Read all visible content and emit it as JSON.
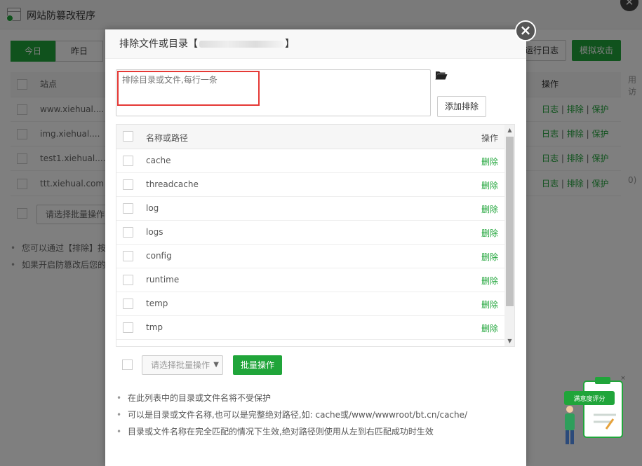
{
  "window": {
    "title": "网站防篡改程序"
  },
  "tabs": [
    {
      "label": "今日"
    },
    {
      "label": "昨日"
    }
  ],
  "toolbar": {
    "log_button": "运行日志",
    "simulate_button": "模拟攻击"
  },
  "bg_table": {
    "headers": {
      "site": "站点",
      "ops": "操作"
    },
    "rows": [
      {
        "name": "www.xiehual...."
      },
      {
        "name": "img.xiehual...."
      },
      {
        "name": "test1.xiehual...."
      },
      {
        "name": "ttt.xiehual.com"
      }
    ],
    "op_log": "日志",
    "op_exclude": "排除",
    "op_protect": "保护",
    "sep": "|"
  },
  "bg_batch": {
    "placeholder": "请选择批量操作"
  },
  "bg_tips": [
    "您可以通过【排除】按",
    "如果开启防篡改后您的"
  ],
  "side_edge": {
    "top": "用访",
    "bottom": "0)"
  },
  "modal": {
    "title_prefix": "排除文件或目录【",
    "title_suffix": "】",
    "textarea_placeholder": "排除目录或文件,每行一条",
    "add_button": "添加排除",
    "list": {
      "header_name": "名称或路径",
      "header_op": "操作",
      "delete_label": "删除",
      "rows": [
        {
          "name": "cache"
        },
        {
          "name": "threadcache"
        },
        {
          "name": "log"
        },
        {
          "name": "logs"
        },
        {
          "name": "config"
        },
        {
          "name": "runtime"
        },
        {
          "name": "temp"
        },
        {
          "name": "tmp"
        }
      ]
    },
    "batch_placeholder": "请选择批量操作",
    "batch_button": "批量操作",
    "tips": [
      "在此列表中的目录或文件名将不受保护",
      "可以是目录或文件名称,也可以是完整绝对路径,如: cache或/www/wwwroot/bt.cn/cache/",
      "目录或文件名称在完全匹配的情况下生效,绝对路径则使用从左到右匹配成功时生效"
    ]
  },
  "satisfaction": {
    "label": "满意度评分"
  },
  "colors": {
    "accent": "#20a53a",
    "highlight": "#e53935"
  }
}
